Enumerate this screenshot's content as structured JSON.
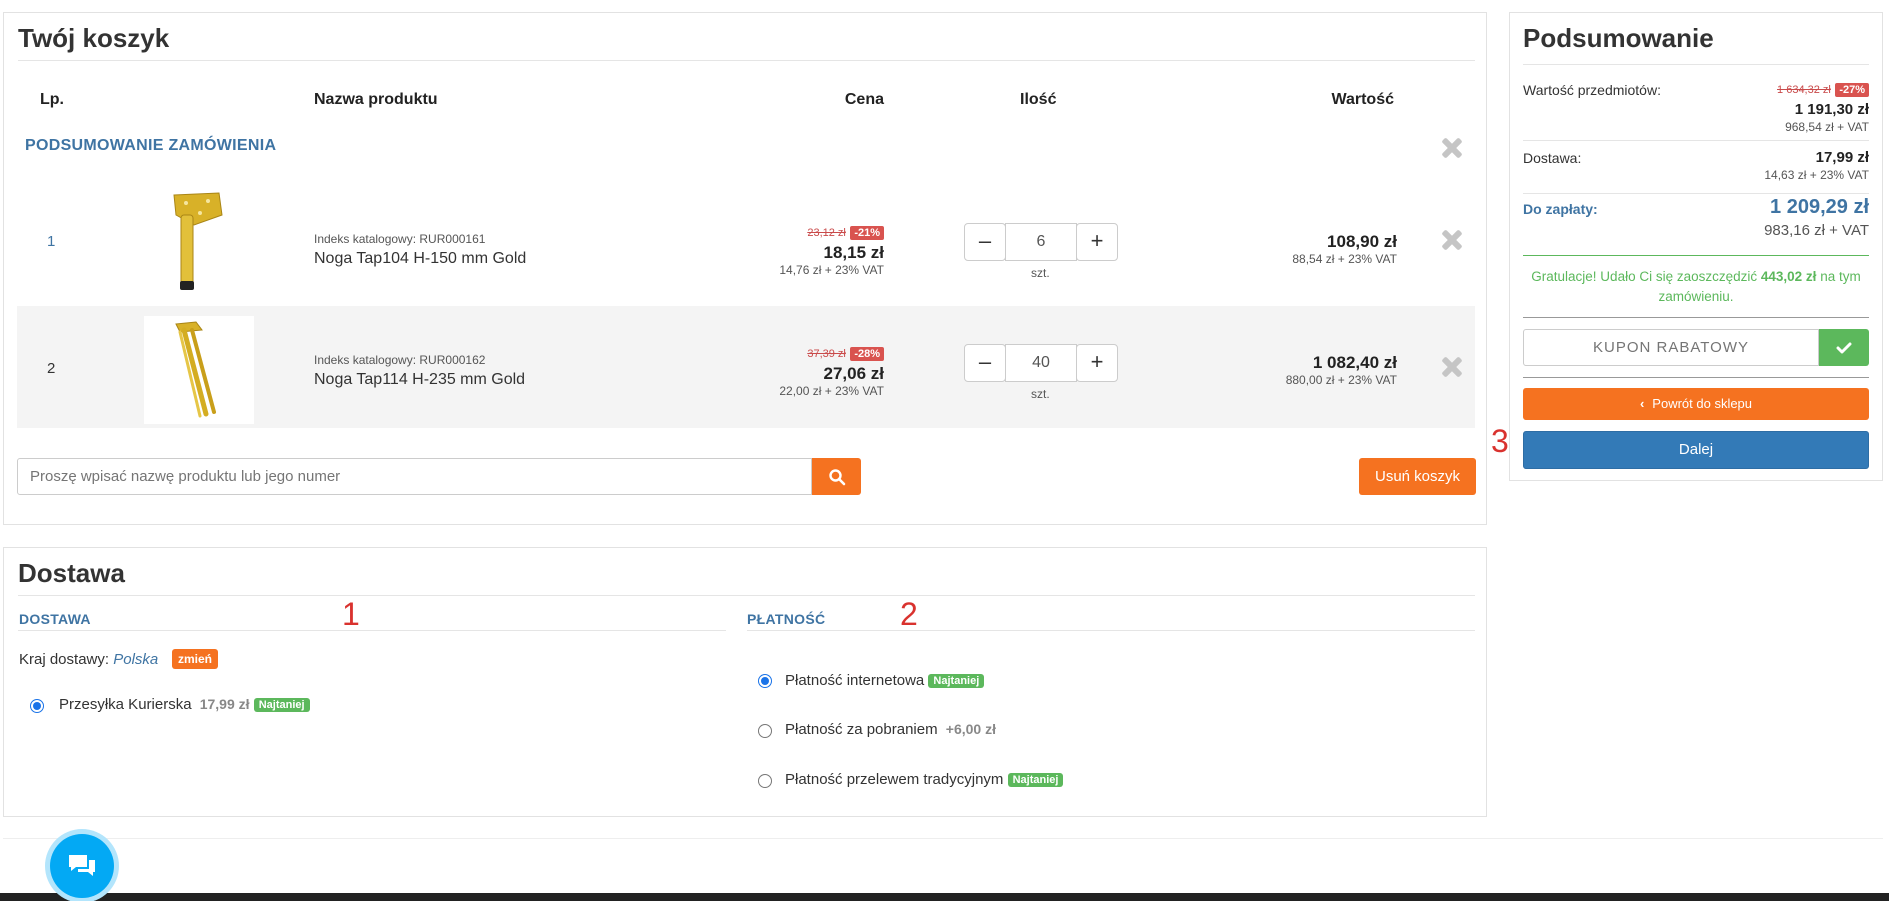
{
  "cart": {
    "title": "Twój koszyk",
    "columns": {
      "lp": "Lp.",
      "name": "Nazwa produktu",
      "price": "Cena",
      "qty": "Ilość",
      "value": "Wartość"
    },
    "section_label": "PODSUMOWANIE ZAMÓWIENIA",
    "items": [
      {
        "lp": "1",
        "catalog": "Indeks katalogowy: RUR000161",
        "name": "Noga Tap104 H-150 mm Gold",
        "old_price": "23,12 zł",
        "discount": "-21%",
        "price": "18,15 zł",
        "net": "14,76 zł + 23% VAT",
        "qty": "6",
        "unit": "szt.",
        "value": "108,90 zł",
        "value_net": "88,54 zł + 23% VAT"
      },
      {
        "lp": "2",
        "catalog": "Indeks katalogowy: RUR000162",
        "name": "Noga Tap114 H-235 mm Gold",
        "old_price": "37,39 zł",
        "discount": "-28%",
        "price": "27,06 zł",
        "net": "22,00 zł + 23% VAT",
        "qty": "40",
        "unit": "szt.",
        "value": "1 082,40 zł",
        "value_net": "880,00 zł + 23% VAT"
      }
    ],
    "search_placeholder": "Proszę wpisać nazwę produktu lub jego numer",
    "clear_label": "Usuń koszyk"
  },
  "summary": {
    "title": "Podsumowanie",
    "items_label": "Wartość przedmiotów:",
    "items_old": "1 634,32 zł",
    "items_discount": "-27%",
    "items_value": "1 191,30 zł",
    "items_net": "968,54 zł + VAT",
    "delivery_label": "Dostawa:",
    "delivery_value": "17,99 zł",
    "delivery_net": "14,63 zł + 23% VAT",
    "total_label": "Do zapłaty:",
    "total_value": "1 209,29 zł",
    "total_net": "983,16 zł + VAT",
    "congrats_pre": "Gratulacje! Udało Ci się zaoszczędzić",
    "congrats_amount": "443,02 zł",
    "congrats_post": "na tym zamówieniu.",
    "coupon_placeholder": "KUPON RABATOWY",
    "back_label": "Powrót do sklepu",
    "next_label": "Dalej"
  },
  "delivery": {
    "title": "Dostawa",
    "delivery_header": "DOSTAWA",
    "payment_header": "PŁATNOŚĆ",
    "country_label": "Kraj dostawy:",
    "country_value": "Polska",
    "change_label": "zmień",
    "shipping_option": "Przesyłka Kurierska",
    "shipping_price": "17,99 zł",
    "cheapest": "Najtaniej",
    "payments": [
      {
        "label": "Płatność internetowa",
        "extra": "",
        "badge": "Najtaniej"
      },
      {
        "label": "Płatność za pobraniem",
        "extra": "+6,00 zł",
        "badge": ""
      },
      {
        "label": "Płatność przelewem tradycyjnym",
        "extra": "",
        "badge": "Najtaniej"
      }
    ]
  },
  "annotations": {
    "a1": "1",
    "a2": "2",
    "a3": "3"
  },
  "colors": {
    "accent_orange": "#f57220",
    "accent_blue": "#337ab7",
    "discount_red": "#d9534f",
    "badge_green": "#5cb85c",
    "chat_blue": "#03a9f4"
  }
}
